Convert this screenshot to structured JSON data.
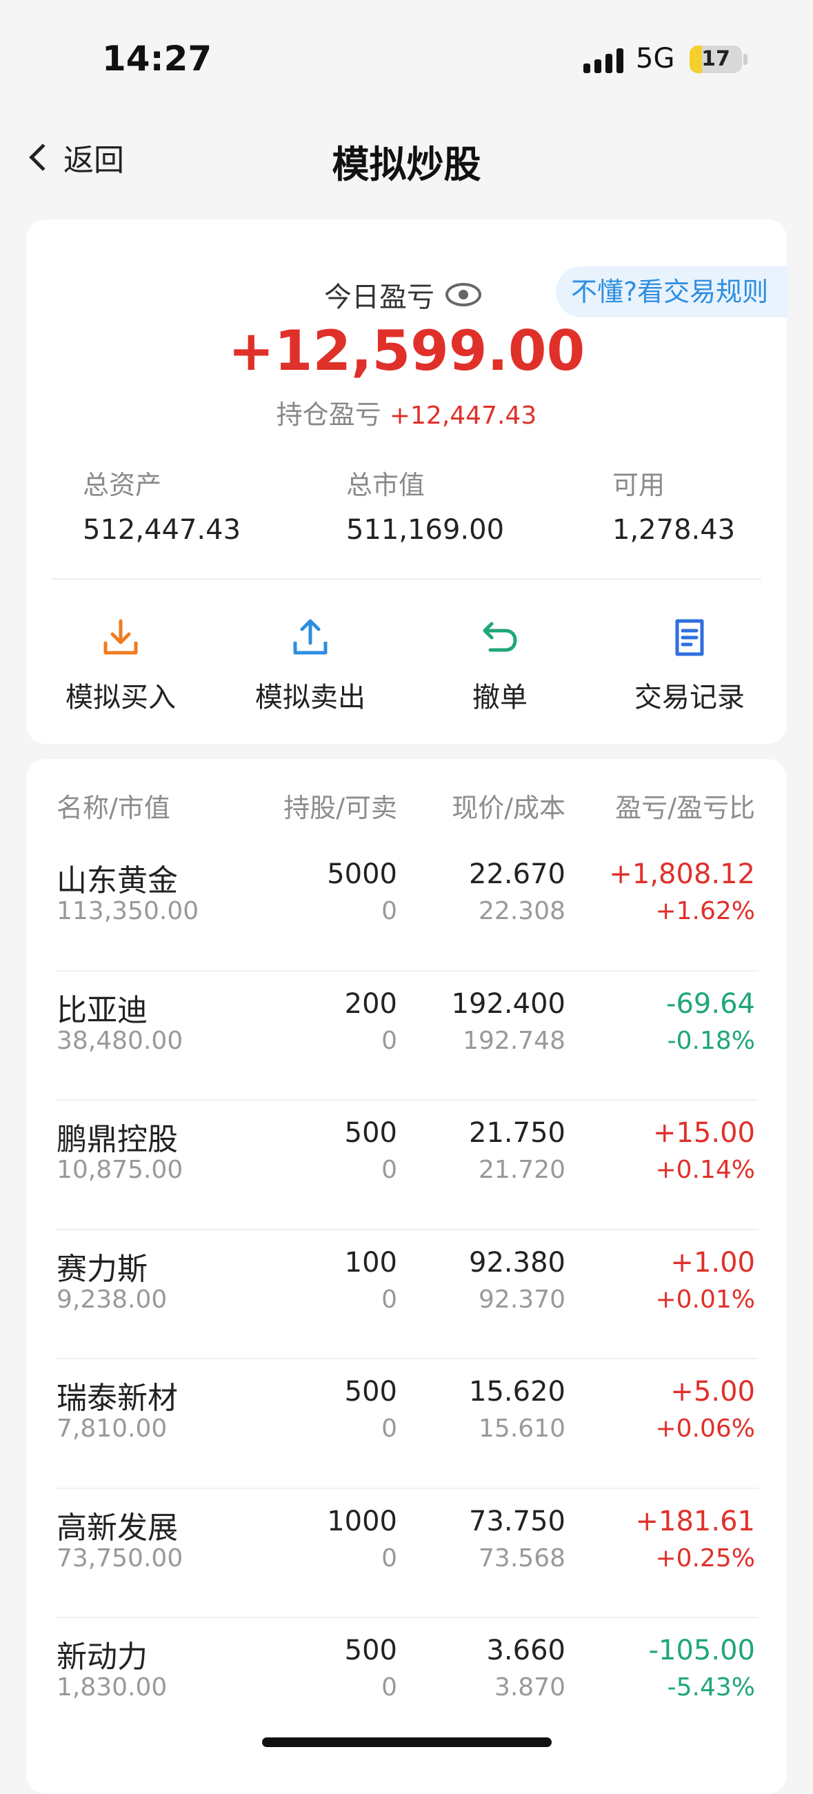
{
  "status_bar": {
    "time": "14:27",
    "network": "5G",
    "battery": "17"
  },
  "nav": {
    "back_label": "返回",
    "title": "模拟炒股"
  },
  "summary": {
    "today_label": "今日盈亏",
    "today_value": "+12,599.00",
    "rules_link": "不懂?看交易规则",
    "hold_label": "持仓盈亏",
    "hold_value": "+12,447.43",
    "stats": [
      {
        "label": "总资产",
        "value": "512,447.43"
      },
      {
        "label": "总市值",
        "value": "511,169.00"
      },
      {
        "label": "可用",
        "value": "1,278.43"
      }
    ]
  },
  "actions": [
    {
      "label": "模拟买入",
      "icon": "download-tray-icon",
      "color": "#f07b22"
    },
    {
      "label": "模拟卖出",
      "icon": "upload-tray-icon",
      "color": "#2e8ee0"
    },
    {
      "label": "撤单",
      "icon": "undo-arrow-icon",
      "color": "#1fa67a"
    },
    {
      "label": "交易记录",
      "icon": "document-icon",
      "color": "#2e6fe0"
    }
  ],
  "table": {
    "headers": [
      "名称/市值",
      "持股/可卖",
      "现价/成本",
      "盈亏/盈亏比"
    ],
    "rows": [
      {
        "name": "山东黄金",
        "value": "113,350.00",
        "shares": "5000",
        "sellable": "0",
        "price": "22.670",
        "cost": "22.308",
        "pnl": "+1,808.12",
        "pnl_pct": "+1.62%",
        "trend": "up"
      },
      {
        "name": "比亚迪",
        "value": "38,480.00",
        "shares": "200",
        "sellable": "0",
        "price": "192.400",
        "cost": "192.748",
        "pnl": "-69.64",
        "pnl_pct": "-0.18%",
        "trend": "down"
      },
      {
        "name": "鹏鼎控股",
        "value": "10,875.00",
        "shares": "500",
        "sellable": "0",
        "price": "21.750",
        "cost": "21.720",
        "pnl": "+15.00",
        "pnl_pct": "+0.14%",
        "trend": "up"
      },
      {
        "name": "赛力斯",
        "value": "9,238.00",
        "shares": "100",
        "sellable": "0",
        "price": "92.380",
        "cost": "92.370",
        "pnl": "+1.00",
        "pnl_pct": "+0.01%",
        "trend": "up"
      },
      {
        "name": "瑞泰新材",
        "value": "7,810.00",
        "shares": "500",
        "sellable": "0",
        "price": "15.620",
        "cost": "15.610",
        "pnl": "+5.00",
        "pnl_pct": "+0.06%",
        "trend": "up"
      },
      {
        "name": "高新发展",
        "value": "73,750.00",
        "shares": "1000",
        "sellable": "0",
        "price": "73.750",
        "cost": "73.568",
        "pnl": "+181.61",
        "pnl_pct": "+0.25%",
        "trend": "up"
      },
      {
        "name": "新动力",
        "value": "1,830.00",
        "shares": "500",
        "sellable": "0",
        "price": "3.660",
        "cost": "3.870",
        "pnl": "-105.00",
        "pnl_pct": "-5.43%",
        "trend": "down"
      }
    ]
  }
}
